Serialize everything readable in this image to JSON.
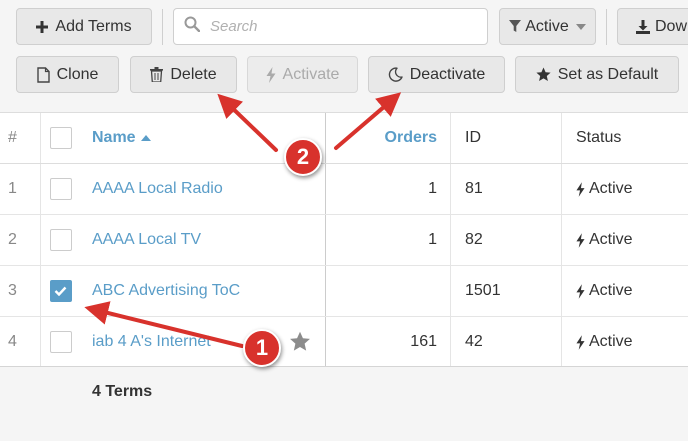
{
  "toolbar": {
    "add_terms": "Add Terms",
    "search_placeholder": "Search",
    "filter_label": "Active",
    "download_label": "Dow",
    "clone": "Clone",
    "delete": "Delete",
    "activate": "Activate",
    "deactivate": "Deactivate",
    "set_default": "Set as Default"
  },
  "table": {
    "headers": {
      "num": "#",
      "name": "Name",
      "orders": "Orders",
      "id": "ID",
      "status": "Status"
    },
    "rows": [
      {
        "num": "1",
        "name": "AAAA Local Radio",
        "orders": "1",
        "id": "81",
        "status": "Active",
        "checked": false
      },
      {
        "num": "2",
        "name": "AAAA Local TV",
        "orders": "1",
        "id": "82",
        "status": "Active",
        "checked": false
      },
      {
        "num": "3",
        "name": "ABC Advertising ToC",
        "orders": "",
        "id": "1501",
        "status": "Active",
        "checked": true
      },
      {
        "num": "4",
        "name": "iab 4 A's Internet",
        "orders": "161",
        "id": "42",
        "status": "Active",
        "checked": false
      }
    ]
  },
  "footer": {
    "count": "4 Terms"
  },
  "annotations": {
    "marker1": "1",
    "marker2": "2"
  },
  "colors": {
    "accent": "#5a9dc8",
    "marker": "#d8322c"
  }
}
